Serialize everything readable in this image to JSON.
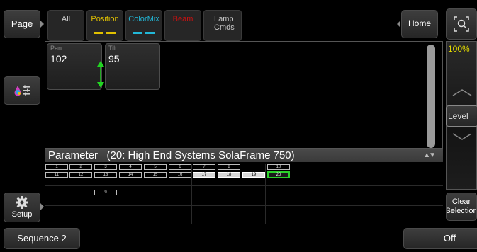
{
  "left": {
    "page_label": "Page",
    "setup_label": "Setup"
  },
  "tabs": [
    {
      "label": "All",
      "color": "#c8c8c8"
    },
    {
      "label": "Position",
      "color": "#e0c000",
      "bar": [
        "#e0c000",
        "#e0c000"
      ]
    },
    {
      "label": "ColorMix",
      "color": "#22b8d8",
      "bar": [
        "#22b8d8",
        "#22b8d8"
      ]
    },
    {
      "label": "Beam",
      "color": "#cc1010"
    },
    {
      "label": "Lamp Cmds",
      "color": "#c8c8c8"
    }
  ],
  "home_label": "Home",
  "encoders": [
    {
      "name": "Pan",
      "value": "102"
    },
    {
      "name": "Tilt",
      "value": "95"
    }
  ],
  "parameter_bar": "Parameter   (20: High End Systems SolaFrame 750)",
  "fixtures": {
    "row1": [
      "1",
      "2",
      "3",
      "4",
      "5",
      "6",
      "7",
      "8",
      "10"
    ],
    "row2": [
      "11",
      "12",
      "13",
      "14",
      "15",
      "16",
      "17",
      "18",
      "19",
      "20"
    ],
    "row3": [
      "9"
    ]
  },
  "right": {
    "fader_percent": "100%",
    "level_label": "Level",
    "clear_label": "Clear Selection"
  },
  "bottom": {
    "sequence_label": "Sequence 2",
    "off_label": "Off"
  }
}
